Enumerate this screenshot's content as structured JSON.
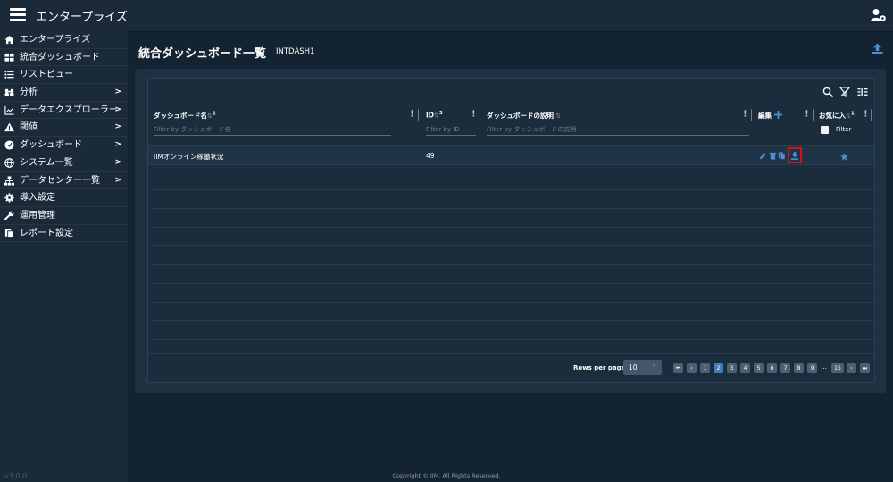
{
  "app": {
    "title": "エンタープライズ",
    "version": "v3.0.0",
    "copyright": "Copyright © IIM. All Rights Reserved."
  },
  "sidebar": {
    "items": [
      {
        "label": "エンタープライズ",
        "icon": "home-icon",
        "has_arrow": false
      },
      {
        "label": "統合ダッシュボード",
        "icon": "grid-icon",
        "has_arrow": false
      },
      {
        "label": "リストビュー",
        "icon": "list-icon",
        "has_arrow": false
      },
      {
        "label": "分析",
        "icon": "binoculars-icon",
        "has_arrow": true
      },
      {
        "label": "データエクスプローラー",
        "icon": "chart-line-icon",
        "has_arrow": true
      },
      {
        "label": "閾値",
        "icon": "warning-icon",
        "has_arrow": true
      },
      {
        "label": "ダッシュボード",
        "icon": "gauge-icon",
        "has_arrow": true
      },
      {
        "label": "システム一覧",
        "icon": "globe-icon",
        "has_arrow": true
      },
      {
        "label": "データセンター一覧",
        "icon": "sitemap-icon",
        "has_arrow": true
      },
      {
        "label": "導入設定",
        "icon": "gear-icon",
        "has_arrow": false
      },
      {
        "label": "運用管理",
        "icon": "wrench-icon",
        "has_arrow": false
      },
      {
        "label": "レポート設定",
        "icon": "copy-icon",
        "has_arrow": false
      }
    ],
    "arrow": ">"
  },
  "page": {
    "title": "統合ダッシュボード一覧",
    "code": "INTDASH1"
  },
  "table": {
    "columns": {
      "name": {
        "label": "ダッシュボード名",
        "sort_rank": "2",
        "filter_placeholder": "Filter by ダッシュボード名"
      },
      "id": {
        "label": "ID",
        "sort_rank": "3",
        "filter_placeholder": "Filter by ID"
      },
      "description": {
        "label": "ダッシュボードの説明",
        "filter_placeholder": "Filter by ダッシュボードの説明"
      },
      "edit": {
        "label": "編集"
      },
      "favorite": {
        "label": "お気に入",
        "sort_rank": "1",
        "filter_label": "Filter"
      }
    },
    "rows": [
      {
        "name": "IIMオンライン稼働状況",
        "id": "49",
        "description": ""
      }
    ]
  },
  "pagination": {
    "rows_per_page_label": "Rows per page",
    "rows_per_page": "10",
    "pages": [
      "1",
      "2",
      "3",
      "4",
      "5",
      "6",
      "7",
      "8",
      "9"
    ],
    "current_page": "2",
    "ellipsis": "…",
    "last_page": "15"
  },
  "colors": {
    "accent": "#3f7fc0",
    "highlight": "#d8101c",
    "background": "#142331",
    "sidebar": "#1b2a39"
  }
}
